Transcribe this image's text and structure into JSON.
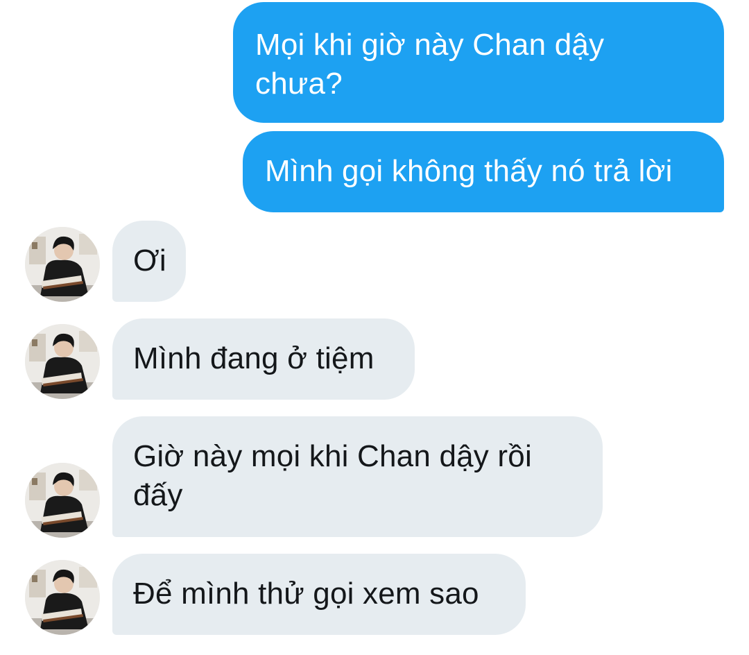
{
  "conversation": {
    "messages": [
      {
        "sender": "me",
        "text": "Mọi khi giờ này Chan dậy chưa?"
      },
      {
        "sender": "me",
        "text": "Mình gọi không thấy nó trả lời"
      },
      {
        "sender": "other",
        "text": "Ơi"
      },
      {
        "sender": "other",
        "text": "Mình đang ở tiệm"
      },
      {
        "sender": "other",
        "text": "Giờ này mọi khi Chan dậy rồi đấy"
      },
      {
        "sender": "other",
        "text": "Để mình thử gọi xem sao"
      }
    ]
  },
  "colors": {
    "sent_bubble": "#1da1f2",
    "received_bubble": "#e6ecf0",
    "received_text": "#14171a",
    "background": "#ffffff"
  }
}
